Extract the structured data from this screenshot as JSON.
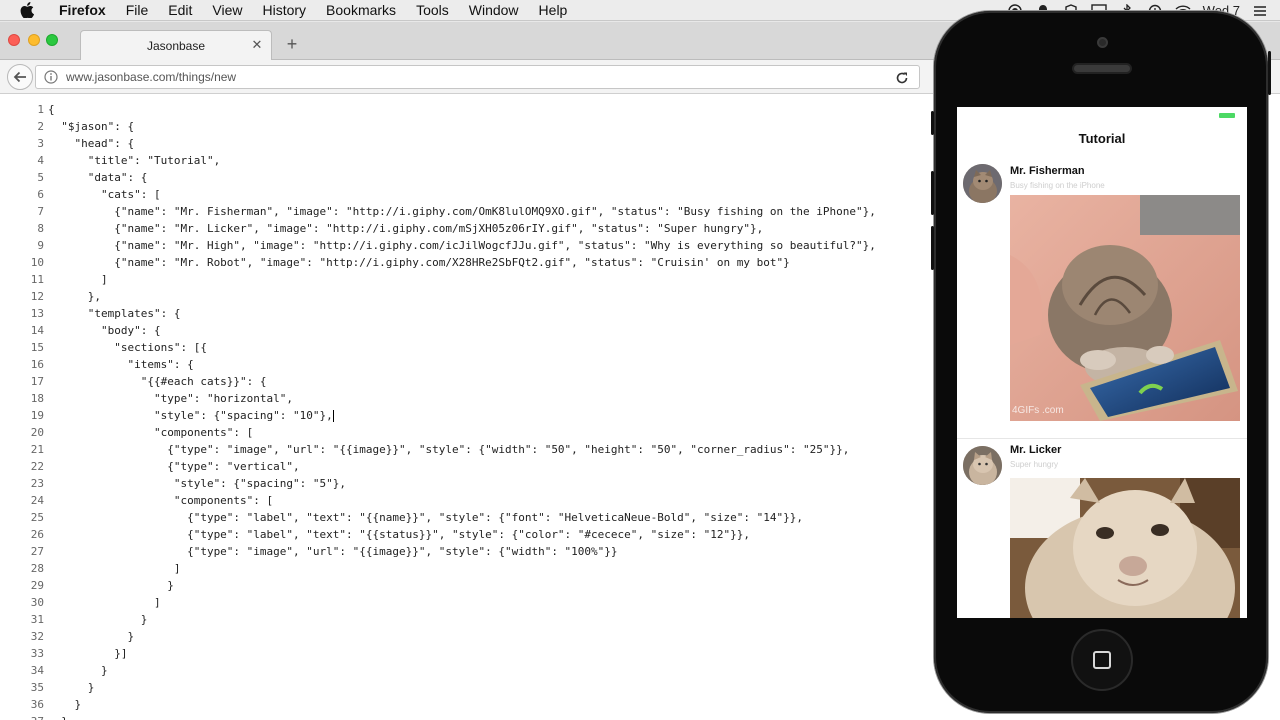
{
  "menubar": {
    "app_name": "Firefox",
    "items": [
      "File",
      "Edit",
      "View",
      "History",
      "Bookmarks",
      "Tools",
      "Window",
      "Help"
    ],
    "clock": "Wed 7"
  },
  "browser": {
    "tab_title": "Jasonbase",
    "url": "www.jasonbase.com/things/new"
  },
  "editor": {
    "lines": [
      {
        "n": "1",
        "text": "{"
      },
      {
        "n": "2",
        "text": "  \"$jason\": {"
      },
      {
        "n": "3",
        "text": "    \"head\": {"
      },
      {
        "n": "4",
        "text": "      \"title\": \"Tutorial\","
      },
      {
        "n": "5",
        "text": "      \"data\": {"
      },
      {
        "n": "6",
        "text": "        \"cats\": ["
      },
      {
        "n": "7",
        "text": "          {\"name\": \"Mr. Fisherman\", \"image\": \"http://i.giphy.com/OmK8lulOMQ9XO.gif\", \"status\": \"Busy fishing on the iPhone\"},"
      },
      {
        "n": "8",
        "text": "          {\"name\": \"Mr. Licker\", \"image\": \"http://i.giphy.com/mSjXH05z06rIY.gif\", \"status\": \"Super hungry\"},"
      },
      {
        "n": "9",
        "text": "          {\"name\": \"Mr. High\", \"image\": \"http://i.giphy.com/icJilWogcfJJu.gif\", \"status\": \"Why is everything so beautiful?\"},"
      },
      {
        "n": "10",
        "text": "          {\"name\": \"Mr. Robot\", \"image\": \"http://i.giphy.com/X28HRe2SbFQt2.gif\", \"status\": \"Cruisin' on my bot\"}"
      },
      {
        "n": "11",
        "text": "        ]"
      },
      {
        "n": "12",
        "text": "      },"
      },
      {
        "n": "13",
        "text": "      \"templates\": {"
      },
      {
        "n": "14",
        "text": "        \"body\": {"
      },
      {
        "n": "15",
        "text": "          \"sections\": [{"
      },
      {
        "n": "16",
        "text": "            \"items\": {"
      },
      {
        "n": "17",
        "text": "              \"{{#each cats}}\": {"
      },
      {
        "n": "18",
        "text": "                \"type\": \"horizontal\","
      },
      {
        "n": "19",
        "text": "                \"style\": {\"spacing\": \"10\"},"
      },
      {
        "n": "20",
        "text": "                \"components\": ["
      },
      {
        "n": "21",
        "text": "                  {\"type\": \"image\", \"url\": \"{{image}}\", \"style\": {\"width\": \"50\", \"height\": \"50\", \"corner_radius\": \"25\"}},"
      },
      {
        "n": "22",
        "text": "                  {\"type\": \"vertical\","
      },
      {
        "n": "23",
        "text": "                   \"style\": {\"spacing\": \"5\"},"
      },
      {
        "n": "24",
        "text": "                   \"components\": ["
      },
      {
        "n": "25",
        "text": "                     {\"type\": \"label\", \"text\": \"{{name}}\", \"style\": {\"font\": \"HelveticaNeue-Bold\", \"size\": \"14\"}},"
      },
      {
        "n": "26",
        "text": "                     {\"type\": \"label\", \"text\": \"{{status}}\", \"style\": {\"color\": \"#cecece\", \"size\": \"12\"}},"
      },
      {
        "n": "27",
        "text": "                     {\"type\": \"image\", \"url\": \"{{image}}\", \"style\": {\"width\": \"100%\"}}"
      },
      {
        "n": "28",
        "text": "                   ]"
      },
      {
        "n": "29",
        "text": "                  }"
      },
      {
        "n": "30",
        "text": "                ]"
      },
      {
        "n": "31",
        "text": "              }"
      },
      {
        "n": "32",
        "text": "            }"
      },
      {
        "n": "33",
        "text": "          }]"
      },
      {
        "n": "34",
        "text": "        }"
      },
      {
        "n": "35",
        "text": "      }"
      },
      {
        "n": "36",
        "text": "    }"
      },
      {
        "n": "37",
        "text": "  }"
      }
    ]
  },
  "phone_app": {
    "title": "Tutorial",
    "cats": [
      {
        "name": "Mr. Fisherman",
        "status": "Busy fishing on the iPhone",
        "watermark": "4GIFs .com"
      },
      {
        "name": "Mr. Licker",
        "status": "Super hungry"
      }
    ],
    "status_color": "#cecece",
    "battery_color": "#4cd964"
  }
}
